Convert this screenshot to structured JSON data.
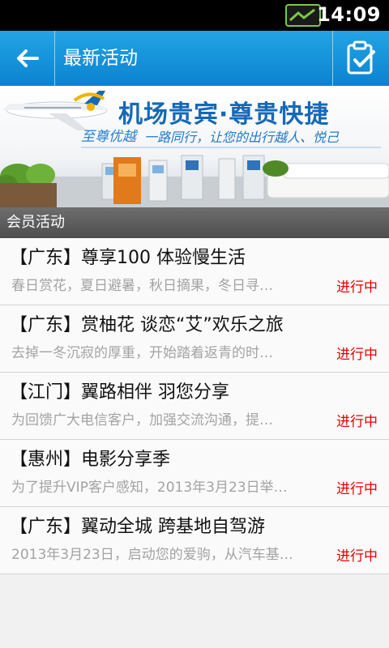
{
  "status_bar": {
    "time": "14:09",
    "signal_icon": "signal-icon"
  },
  "header": {
    "title": "最新活动",
    "back_icon": "arrow-left-icon",
    "action_icon": "clipboard-check-icon"
  },
  "banner": {
    "headline": "机场贵宾·尊贵快捷",
    "tagline_left": "至尊优越",
    "tagline_right": "一路同行，让您的出行越人、悦己"
  },
  "section": {
    "title": "会员活动"
  },
  "items": [
    {
      "title": "【广东】尊享100 体验慢生活",
      "desc": "春日赏花，夏日避暑，秋日摘果，冬日寻…",
      "status": "进行中"
    },
    {
      "title": "【广东】赏柚花 谈恋“艾”欢乐之旅",
      "desc": "去掉一冬沉寂的厚重，开始踏着返青的时…",
      "status": "进行中"
    },
    {
      "title": "【江门】翼路相伴 羽您分享",
      "desc": "为回馈广大电信客户，加强交流沟通，提…",
      "status": "进行中"
    },
    {
      "title": "【惠州】电影分享季",
      "desc": "为了提升VIP客户感知，2013年3月23日举…",
      "status": "进行中"
    },
    {
      "title": "【广东】翼动全城 跨基地自驾游",
      "desc": "2013年3月23日，启动您的爱驹，从汽车基…",
      "status": "进行中"
    }
  ],
  "colors": {
    "accent": "#0a83cf",
    "status": "#e60000",
    "section_bg": "#5a5a5a"
  }
}
